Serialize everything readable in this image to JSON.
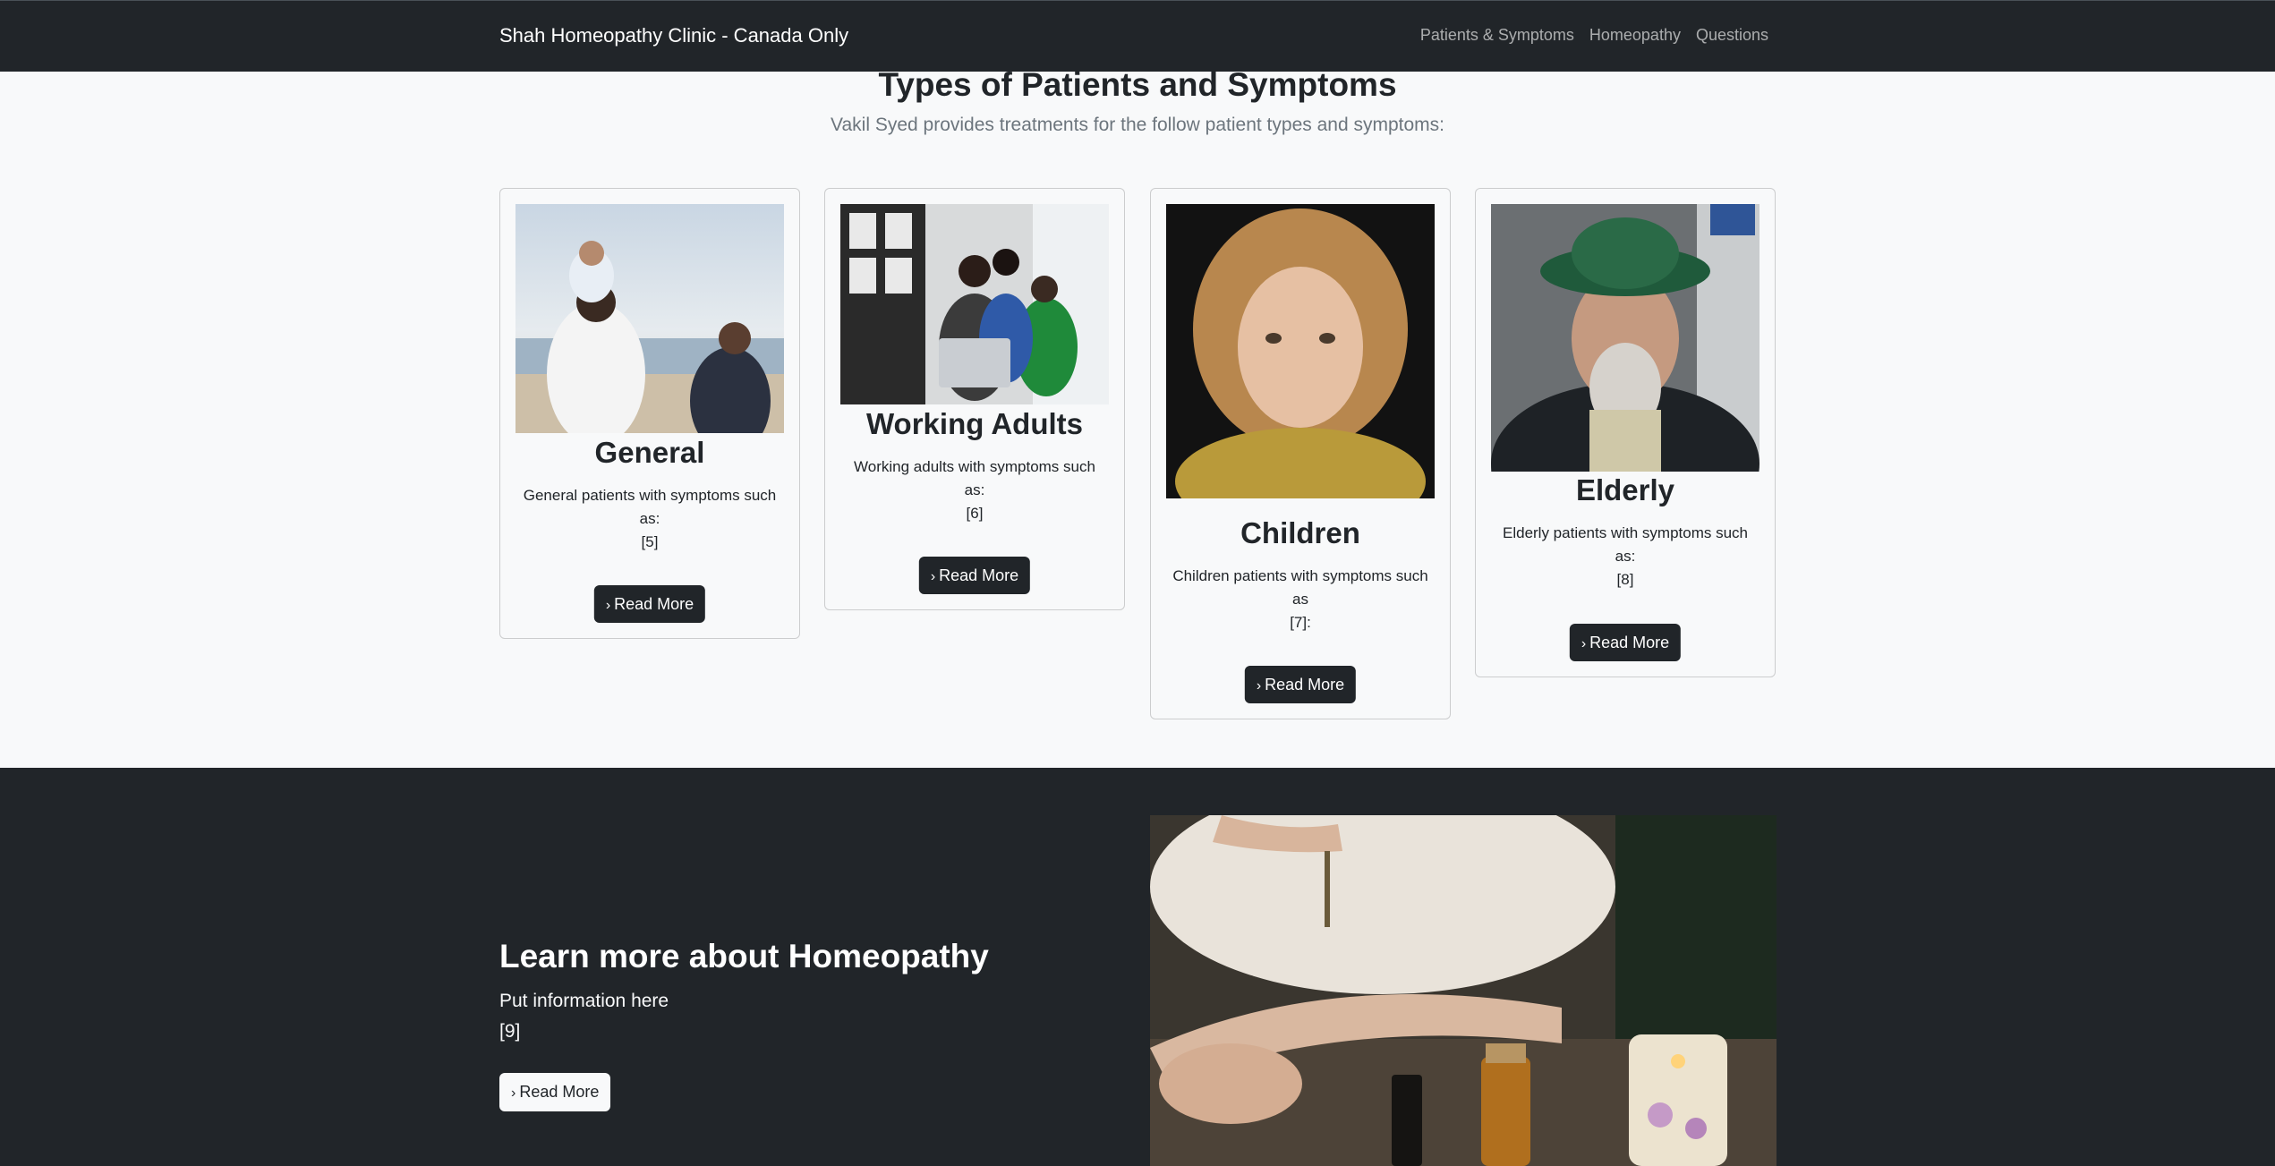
{
  "navbar": {
    "brand": "Shah Homeopathy Clinic - Canada Only",
    "links": [
      "Patients & Symptoms",
      "Homeopathy",
      "Questions"
    ]
  },
  "patients": {
    "title": "Types of Patients and Symptoms",
    "subtitle": "Vakil Syed provides treatments for the follow patient types and symptoms:",
    "cards": [
      {
        "title": "General",
        "text": "General patients with symptoms such as:",
        "ref": "[5]",
        "button": "Read More",
        "image": "family-at-beach-photo"
      },
      {
        "title": "Working Adults",
        "text": "Working adults with symptoms such as:",
        "ref": "[6]",
        "button": "Read More",
        "image": "coworkers-with-laptop-photo"
      },
      {
        "title": "Children",
        "text": "Children patients with symptoms such as",
        "ref": "[7]:",
        "button": "Read More",
        "image": "curly-haired-child-photo"
      },
      {
        "title": "Elderly",
        "text": "Elderly patients with symptoms such as:",
        "ref": "[8]",
        "button": "Read More",
        "image": "elderly-man-green-hat-photo"
      }
    ]
  },
  "homeopathy": {
    "title": "Learn more about Homeopathy",
    "info": "Put information here",
    "ref": "[9]",
    "button": "Read More",
    "image": "essential-oils-dropper-photo"
  },
  "colors": {
    "dark": "#212529",
    "light": "#f8f9fa"
  }
}
